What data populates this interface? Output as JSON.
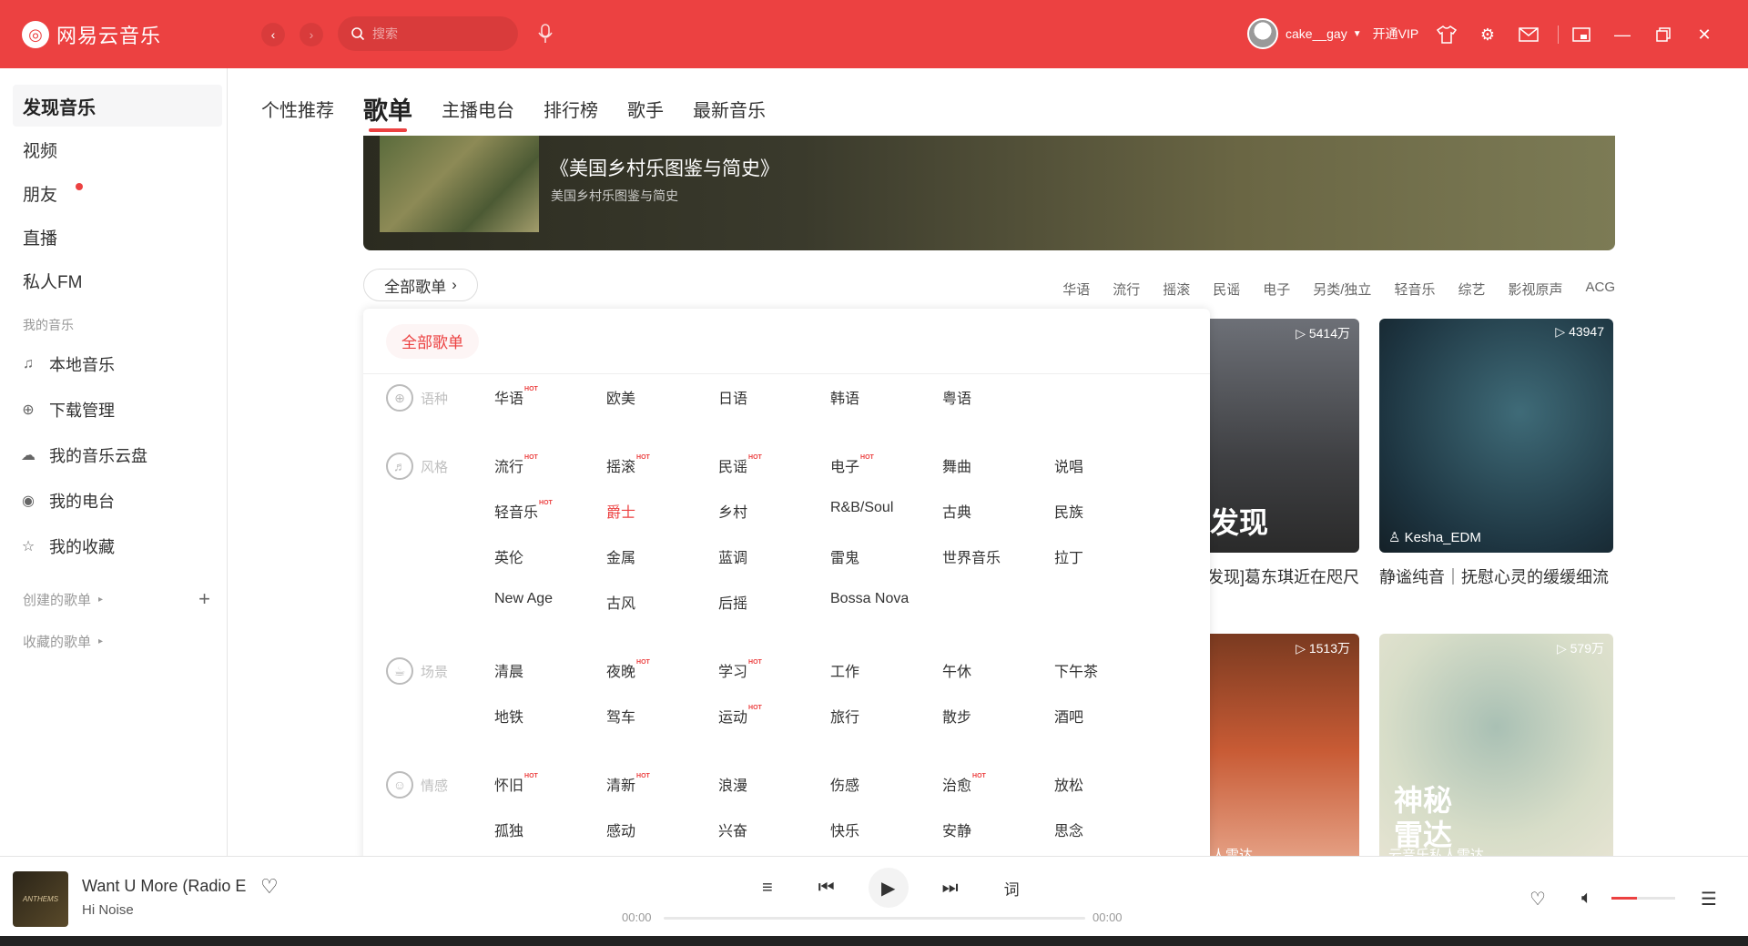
{
  "app": {
    "name": "网易云音乐"
  },
  "header": {
    "search_placeholder": "搜索",
    "user_name": "cake__gay",
    "vip_label": "开通VIP"
  },
  "sidebar": {
    "items": [
      {
        "label": "发现音乐"
      },
      {
        "label": "视频"
      },
      {
        "label": "朋友"
      },
      {
        "label": "直播"
      },
      {
        "label": "私人FM"
      }
    ],
    "section_my_music": "我的音乐",
    "my_items": [
      {
        "label": "本地音乐",
        "icon": "music-note-icon"
      },
      {
        "label": "下载管理",
        "icon": "download-icon"
      },
      {
        "label": "我的音乐云盘",
        "icon": "cloud-icon"
      },
      {
        "label": "我的电台",
        "icon": "radio-icon"
      },
      {
        "label": "我的收藏",
        "icon": "collect-icon"
      }
    ],
    "created_playlists": "创建的歌单",
    "collected_playlists": "收藏的歌单"
  },
  "tabs": [
    "个性推荐",
    "歌单",
    "主播电台",
    "排行榜",
    "歌手",
    "最新音乐"
  ],
  "banner": {
    "title": "《美国乡村乐图鉴与简史》",
    "subtitle": "美国乡村乐图鉴与简史"
  },
  "all_playlists_button": "全部歌单",
  "hot_tags": [
    "华语",
    "流行",
    "摇滚",
    "民谣",
    "电子",
    "另类/独立",
    "轻音乐",
    "综艺",
    "影视原声",
    "ACG"
  ],
  "cards": [
    {
      "plays": "5414万",
      "title": "[发现]葛东琪近在咫尺",
      "overlay": "发现"
    },
    {
      "plays": "43947",
      "title": "静谧纯音｜抚慰心灵的缓缓细流",
      "owner": "Kesha_EDM"
    },
    {
      "plays": "1513万",
      "owner": "人雷达"
    },
    {
      "plays": "579万",
      "overlay": "神秘雷达",
      "owner": "云音乐私人雷达"
    }
  ],
  "popup": {
    "all_chip": "全部歌单",
    "hot_label": "HOT",
    "categories": [
      {
        "name": "语种",
        "tags": [
          [
            "华语",
            true
          ],
          [
            "欧美",
            false
          ],
          [
            "日语",
            false
          ],
          [
            "韩语",
            false
          ],
          [
            "粤语",
            false
          ]
        ]
      },
      {
        "name": "风格",
        "tags": [
          [
            "流行",
            true
          ],
          [
            "摇滚",
            true
          ],
          [
            "民谣",
            true
          ],
          [
            "电子",
            true
          ],
          [
            "舞曲",
            false
          ],
          [
            "说唱",
            false
          ],
          [
            "轻音乐",
            true
          ],
          [
            "爵士",
            false
          ],
          [
            "乡村",
            false
          ],
          [
            "R&B/Soul",
            false
          ],
          [
            "古典",
            false
          ],
          [
            "民族",
            false
          ],
          [
            "英伦",
            false
          ],
          [
            "金属",
            false
          ],
          [
            "蓝调",
            false
          ],
          [
            "雷鬼",
            false
          ],
          [
            "世界音乐",
            false
          ],
          [
            "拉丁",
            false
          ],
          [
            "New Age",
            false
          ],
          [
            "古风",
            false
          ],
          [
            "后摇",
            false
          ],
          [
            "Bossa Nova",
            false
          ]
        ]
      },
      {
        "name": "场景",
        "tags": [
          [
            "清晨",
            false
          ],
          [
            "夜晚",
            true
          ],
          [
            "学习",
            true
          ],
          [
            "工作",
            false
          ],
          [
            "午休",
            false
          ],
          [
            "下午茶",
            false
          ],
          [
            "地铁",
            false
          ],
          [
            "驾车",
            false
          ],
          [
            "运动",
            true
          ],
          [
            "旅行",
            false
          ],
          [
            "散步",
            false
          ],
          [
            "酒吧",
            false
          ]
        ]
      },
      {
        "name": "情感",
        "tags": [
          [
            "怀旧",
            true
          ],
          [
            "清新",
            true
          ],
          [
            "浪漫",
            false
          ],
          [
            "伤感",
            false
          ],
          [
            "治愈",
            true
          ],
          [
            "放松",
            false
          ],
          [
            "孤独",
            false
          ],
          [
            "感动",
            false
          ],
          [
            "兴奋",
            false
          ],
          [
            "快乐",
            false
          ],
          [
            "安静",
            false
          ],
          [
            "思念",
            false
          ]
        ]
      }
    ]
  },
  "player": {
    "cover_text": "ANTHEMS",
    "song": "Want U More (Radio E",
    "artist": "Hi Noise",
    "time_current": "00:00",
    "time_total": "00:00",
    "lyric_label": "词"
  }
}
